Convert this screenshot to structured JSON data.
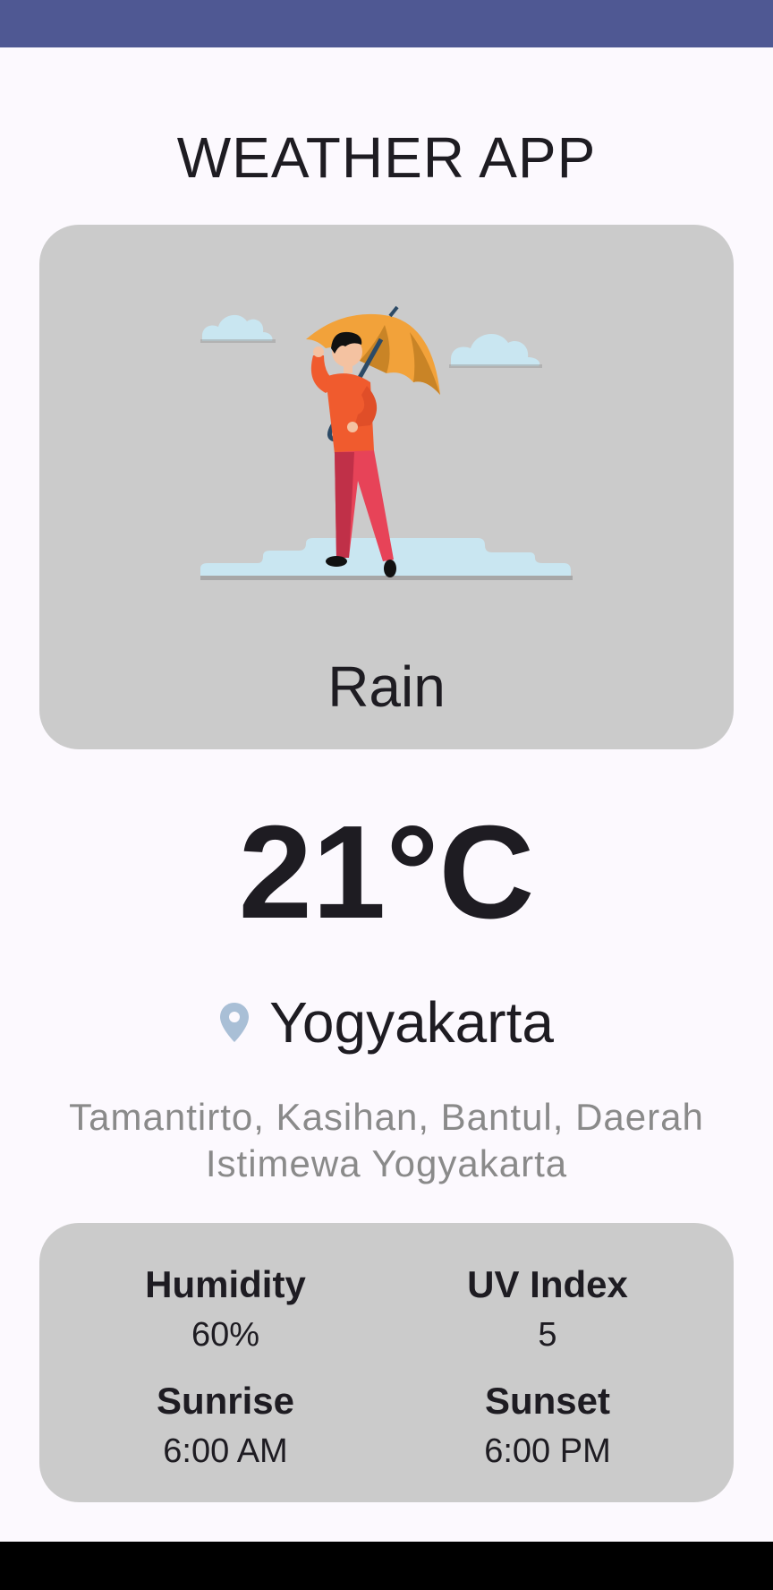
{
  "app": {
    "title": "WEATHER APP"
  },
  "weather": {
    "condition": "Rain",
    "illustration": "person-with-umbrella-rain-illustration",
    "temperature": "21°C"
  },
  "location": {
    "icon": "location-pin-icon",
    "city": "Yogyakarta",
    "address": "Tamantirto, Kasihan, Bantul, Daerah Istimewa Yogyakarta"
  },
  "details": {
    "humidity": {
      "label": "Humidity",
      "value": "60%"
    },
    "uv_index": {
      "label": "UV Index",
      "value": "5"
    },
    "sunrise": {
      "label": "Sunrise",
      "value": "6:00 AM"
    },
    "sunset": {
      "label": "Sunset",
      "value": "6:00 PM"
    }
  },
  "colors": {
    "status_bar": "#4f5893",
    "background": "#fcf9fe",
    "card": "#cbcbcb",
    "text_primary": "#1e1c22",
    "text_secondary": "#8a8a8a",
    "pin": "#a9bfd6"
  }
}
